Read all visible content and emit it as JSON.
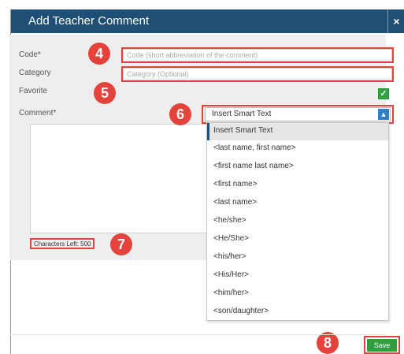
{
  "dialog": {
    "title": "Add Teacher Comment",
    "close_label": "×"
  },
  "form": {
    "code_label": "Code*",
    "code_placeholder": "Code (short abbreviation of the comment)",
    "category_label": "Category",
    "category_placeholder": "Category (Optional)",
    "favorite_label": "Favorite",
    "favorite_checked": true,
    "comment_label": "Comment*",
    "characters_left": "Characters Left: 500"
  },
  "smart_text": {
    "selected": "Insert Smart Text",
    "options": [
      "Insert Smart Text",
      "<last name, first name>",
      "<first name last name>",
      "<first name>",
      "<last name>",
      "<he/she>",
      "<He/She>",
      "<his/her>",
      "<His/Her>",
      "<him/her>",
      "<son/daughter>"
    ]
  },
  "markers": {
    "m4": "4",
    "m5": "5",
    "m6": "6",
    "m7": "7",
    "m8": "8"
  },
  "footer": {
    "save_label": "Save"
  },
  "colors": {
    "titlebar": "#1f4f74",
    "annotation_red": "#e4423a",
    "save_green": "#2e9e3e",
    "dropdown_arrow": "#2f7ec7"
  },
  "icons": {
    "favorite": "check-icon",
    "select": "chevron-up-icon",
    "close": "close-icon"
  }
}
